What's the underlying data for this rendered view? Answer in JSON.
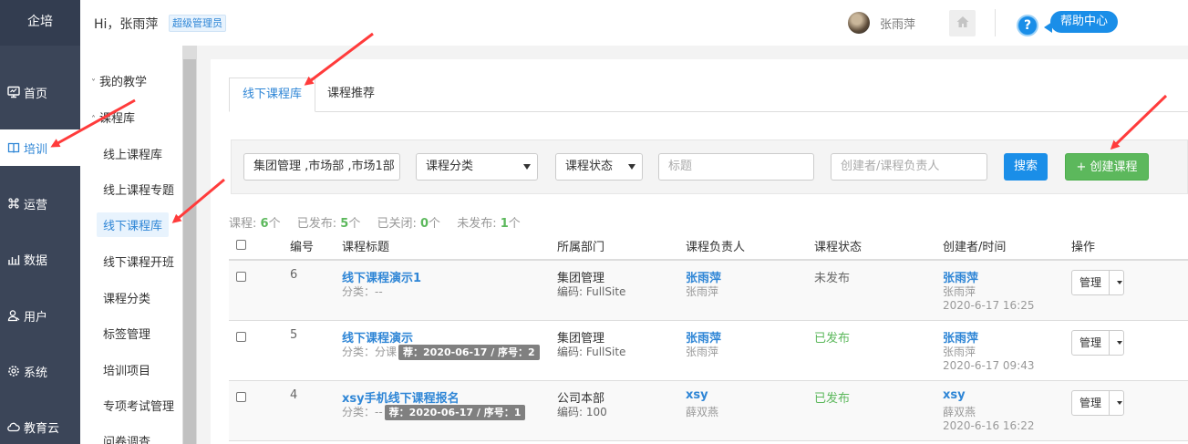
{
  "brand": "企培",
  "left_nav": [
    {
      "label": "首页",
      "icon": "monitor-icon",
      "active": false
    },
    {
      "label": "培训",
      "icon": "book-icon",
      "active": true
    },
    {
      "label": "运营",
      "icon": "command-icon",
      "active": false
    },
    {
      "label": "数据",
      "icon": "bar-chart-icon",
      "active": false
    },
    {
      "label": "用户",
      "icon": "user-icon",
      "active": false
    },
    {
      "label": "系统",
      "icon": "gear-icon",
      "active": false
    },
    {
      "label": "教育云",
      "icon": "cloud-icon",
      "active": false
    }
  ],
  "header": {
    "greeting": "Hi，张雨萍",
    "role": "超级管理员",
    "username": "张雨萍",
    "help_label": "帮助中心",
    "help_q": "?"
  },
  "submenu": {
    "group_teaching": "我的教学",
    "group_courses": "课程库",
    "items": [
      "线上课程库",
      "线上课程专题",
      "线下课程库",
      "线下课程开班",
      "课程分类",
      "标签管理",
      "培训项目",
      "专项考试管理",
      "问卷调查"
    ],
    "active_index": 2
  },
  "tabs": [
    {
      "label": "线下课程库",
      "active": true
    },
    {
      "label": "课程推荐",
      "active": false
    }
  ],
  "filters": {
    "department_value": "集团管理 ,市场部 ,市场1部",
    "category_value": "课程分类",
    "status_value": "课程状态",
    "title_placeholder": "标题",
    "creator_placeholder": "创建者/课程负责人",
    "search_label": "搜索",
    "create_label": "+ 创建课程"
  },
  "stats": {
    "total_label": "课程:",
    "total": "6",
    "total_unit": "个",
    "published_label": "已发布:",
    "published": "5",
    "published_unit": "个",
    "closed_label": "已关闭:",
    "closed": "0",
    "closed_unit": "个",
    "unpublished_label": "未发布:",
    "unpublished": "1",
    "unpublished_unit": "个"
  },
  "table": {
    "headers": [
      "编号",
      "课程标题",
      "所属部门",
      "课程负责人",
      "课程状态",
      "创建者/时间",
      "操作"
    ],
    "rows": [
      {
        "id": "6",
        "title": "线下课程演示1",
        "category": "分类：--",
        "tag": "",
        "dept": "集团管理",
        "dept_code": "编码: FullSite",
        "owner": "张雨萍",
        "owner_sub": "张雨萍",
        "status": "未发布",
        "status_color": "#666666",
        "creator": "张雨萍",
        "creator_sub": "张雨萍",
        "created": "2020-6-17 16:25",
        "action": "管理"
      },
      {
        "id": "5",
        "title": "线下课程演示",
        "category": "分类：分课",
        "tag": "荐：2020-06-17 / 序号：2",
        "dept": "集团管理",
        "dept_code": "编码: FullSite",
        "owner": "张雨萍",
        "owner_sub": "张雨萍",
        "status": "已发布",
        "status_color": "#5cb85c",
        "creator": "张雨萍",
        "creator_sub": "张雨萍",
        "created": "2020-6-17 09:43",
        "action": "管理"
      },
      {
        "id": "4",
        "title": "xsy手机线下课程报名",
        "category": "分类：--",
        "tag": "荐：2020-06-17 / 序号：1",
        "dept": "公司本部",
        "dept_code": "编码: 100",
        "owner": "xsy",
        "owner_sub": "薛双燕",
        "status": "已发布",
        "status_color": "#5cb85c",
        "creator": "xsy",
        "creator_sub": "薛双燕",
        "created": "2020-6-16 16:22",
        "action": "管理"
      }
    ]
  },
  "colors": {
    "accent": "#2f86d6",
    "nav_bg": "#3b4558",
    "success": "#5cb85c",
    "annotation": "#ff3b3b"
  }
}
